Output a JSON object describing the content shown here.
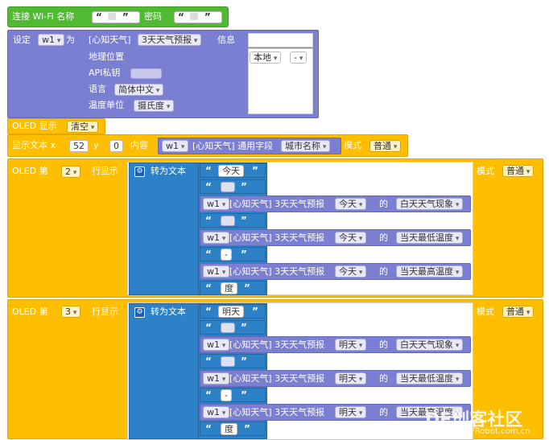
{
  "wifi": {
    "label": "连接 Wi-Fi 名称",
    "pwd_label": "密码",
    "q_open": "“",
    "q_close": "”"
  },
  "setblock": {
    "label_set": "设定",
    "var": "w1",
    "label_as": "为",
    "service": "[心知天气]",
    "forecast": "3天天气预报",
    "info": "信息",
    "location_label": "地理位置",
    "location_value": "本地",
    "location_sub": "-",
    "api_label": "API私钥",
    "lang_label": "语言",
    "lang_value": "简体中文",
    "unit_label": "温度单位",
    "unit_value": "摄氏度"
  },
  "oled_show": {
    "label": "OLED 显示",
    "value": "清空"
  },
  "show_text": {
    "label": "显示文本 x",
    "x": "52",
    "y_label": "y",
    "y": "0",
    "content_label": "内容",
    "var": "w1",
    "service": "[心知天气] 通用字段",
    "field": "城市名称",
    "mode_label": "模式",
    "mode": "普通"
  },
  "oled_rows": [
    {
      "label": "OLED 第",
      "row": "2",
      "suffix": "行显示",
      "convert": "转为文本",
      "mode_label": "模式",
      "mode": "普通",
      "day_text": "今天",
      "day": "今天",
      "sep": "-",
      "deg": "度",
      "items": [
        "白天天气现象",
        "当天最低温度",
        "当天最高温度"
      ]
    },
    {
      "label": "OLED 第",
      "row": "3",
      "suffix": "行显示",
      "convert": "转为文本",
      "mode_label": "模式",
      "mode": "普通",
      "day_text": "明天",
      "day": "明天",
      "sep": "-",
      "deg": "度",
      "items": [
        "白天天气现象",
        "当天最低温度",
        "当天最高温度"
      ]
    }
  ],
  "line": {
    "var": "w1",
    "service": "[心知天气] 3天天气预报",
    "of": "的"
  },
  "watermark": {
    "text": "DF创客社区",
    "url": "mc.DFRobot.com.cn"
  },
  "colors": {
    "green": "#4fba32",
    "purple": "#7b7fd1",
    "orange": "#ffbf00",
    "blue": "#2d81c6"
  }
}
